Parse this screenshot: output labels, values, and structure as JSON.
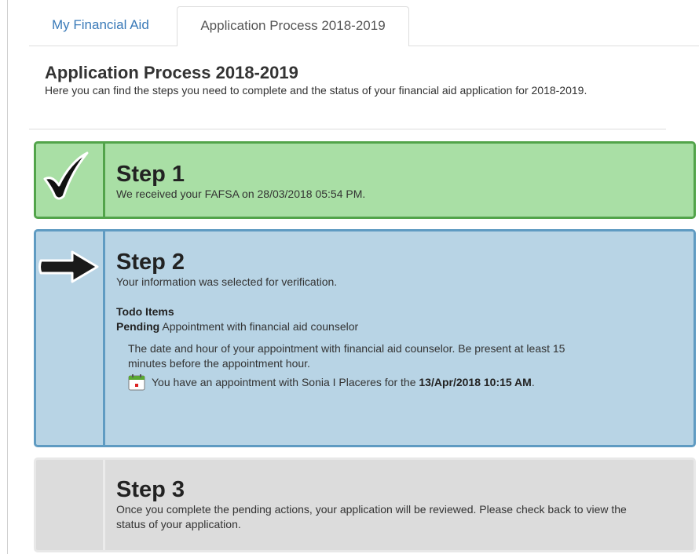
{
  "tabs": [
    {
      "label": "My Financial Aid",
      "active": false
    },
    {
      "label": "Application Process 2018-2019",
      "active": true
    }
  ],
  "page": {
    "title": "Application Process 2018-2019",
    "description": "Here you can find the steps you need to complete and the status of your financial aid application for 2018-2019."
  },
  "steps": [
    {
      "title": "Step 1",
      "status": "complete",
      "icon": "checkmark-icon",
      "text": "We received your FAFSA on 28/03/2018 05:54 PM."
    },
    {
      "title": "Step 2",
      "status": "current",
      "icon": "arrow-right-icon",
      "text": "Your information was selected for verification.",
      "todo_heading": "Todo Items",
      "todo_status": "Pending",
      "todo_label": "Appointment with financial aid counselor",
      "todo_detail": "The date and hour of your appointment with financial aid counselor. Be present at least 15 minutes before the appointment hour.",
      "appointment_prefix": "You have an appointment with Sonia I Placeres for the",
      "appointment_datetime": "13/Apr/2018 10:15 AM",
      "appointment_suffix": "."
    },
    {
      "title": "Step 3",
      "status": "upcoming",
      "text": "Once you complete the pending actions, your application will be reviewed. Please check back to view the status of your application."
    }
  ],
  "colors": {
    "complete_bg": "#a9dfa5",
    "complete_border": "#52a44a",
    "current_bg": "#b8d4e5",
    "current_border": "#5f9bc2",
    "upcoming_bg": "#dcdcdc",
    "link": "#3a7ab8"
  }
}
